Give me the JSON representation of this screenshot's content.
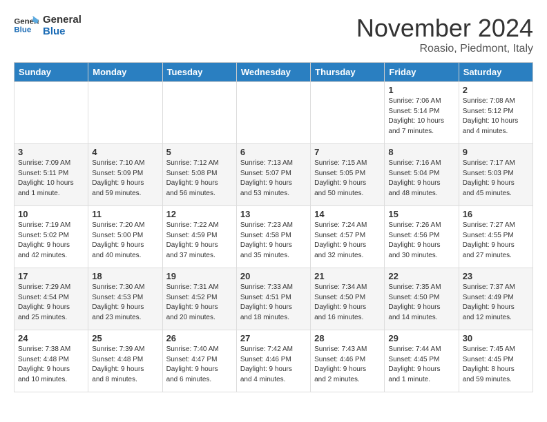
{
  "header": {
    "logo_line1": "General",
    "logo_line2": "Blue",
    "month": "November 2024",
    "location": "Roasio, Piedmont, Italy"
  },
  "weekdays": [
    "Sunday",
    "Monday",
    "Tuesday",
    "Wednesday",
    "Thursday",
    "Friday",
    "Saturday"
  ],
  "weeks": [
    [
      {
        "day": "",
        "info": ""
      },
      {
        "day": "",
        "info": ""
      },
      {
        "day": "",
        "info": ""
      },
      {
        "day": "",
        "info": ""
      },
      {
        "day": "",
        "info": ""
      },
      {
        "day": "1",
        "info": "Sunrise: 7:06 AM\nSunset: 5:14 PM\nDaylight: 10 hours\nand 7 minutes."
      },
      {
        "day": "2",
        "info": "Sunrise: 7:08 AM\nSunset: 5:12 PM\nDaylight: 10 hours\nand 4 minutes."
      }
    ],
    [
      {
        "day": "3",
        "info": "Sunrise: 7:09 AM\nSunset: 5:11 PM\nDaylight: 10 hours\nand 1 minute."
      },
      {
        "day": "4",
        "info": "Sunrise: 7:10 AM\nSunset: 5:09 PM\nDaylight: 9 hours\nand 59 minutes."
      },
      {
        "day": "5",
        "info": "Sunrise: 7:12 AM\nSunset: 5:08 PM\nDaylight: 9 hours\nand 56 minutes."
      },
      {
        "day": "6",
        "info": "Sunrise: 7:13 AM\nSunset: 5:07 PM\nDaylight: 9 hours\nand 53 minutes."
      },
      {
        "day": "7",
        "info": "Sunrise: 7:15 AM\nSunset: 5:05 PM\nDaylight: 9 hours\nand 50 minutes."
      },
      {
        "day": "8",
        "info": "Sunrise: 7:16 AM\nSunset: 5:04 PM\nDaylight: 9 hours\nand 48 minutes."
      },
      {
        "day": "9",
        "info": "Sunrise: 7:17 AM\nSunset: 5:03 PM\nDaylight: 9 hours\nand 45 minutes."
      }
    ],
    [
      {
        "day": "10",
        "info": "Sunrise: 7:19 AM\nSunset: 5:02 PM\nDaylight: 9 hours\nand 42 minutes."
      },
      {
        "day": "11",
        "info": "Sunrise: 7:20 AM\nSunset: 5:00 PM\nDaylight: 9 hours\nand 40 minutes."
      },
      {
        "day": "12",
        "info": "Sunrise: 7:22 AM\nSunset: 4:59 PM\nDaylight: 9 hours\nand 37 minutes."
      },
      {
        "day": "13",
        "info": "Sunrise: 7:23 AM\nSunset: 4:58 PM\nDaylight: 9 hours\nand 35 minutes."
      },
      {
        "day": "14",
        "info": "Sunrise: 7:24 AM\nSunset: 4:57 PM\nDaylight: 9 hours\nand 32 minutes."
      },
      {
        "day": "15",
        "info": "Sunrise: 7:26 AM\nSunset: 4:56 PM\nDaylight: 9 hours\nand 30 minutes."
      },
      {
        "day": "16",
        "info": "Sunrise: 7:27 AM\nSunset: 4:55 PM\nDaylight: 9 hours\nand 27 minutes."
      }
    ],
    [
      {
        "day": "17",
        "info": "Sunrise: 7:29 AM\nSunset: 4:54 PM\nDaylight: 9 hours\nand 25 minutes."
      },
      {
        "day": "18",
        "info": "Sunrise: 7:30 AM\nSunset: 4:53 PM\nDaylight: 9 hours\nand 23 minutes."
      },
      {
        "day": "19",
        "info": "Sunrise: 7:31 AM\nSunset: 4:52 PM\nDaylight: 9 hours\nand 20 minutes."
      },
      {
        "day": "20",
        "info": "Sunrise: 7:33 AM\nSunset: 4:51 PM\nDaylight: 9 hours\nand 18 minutes."
      },
      {
        "day": "21",
        "info": "Sunrise: 7:34 AM\nSunset: 4:50 PM\nDaylight: 9 hours\nand 16 minutes."
      },
      {
        "day": "22",
        "info": "Sunrise: 7:35 AM\nSunset: 4:50 PM\nDaylight: 9 hours\nand 14 minutes."
      },
      {
        "day": "23",
        "info": "Sunrise: 7:37 AM\nSunset: 4:49 PM\nDaylight: 9 hours\nand 12 minutes."
      }
    ],
    [
      {
        "day": "24",
        "info": "Sunrise: 7:38 AM\nSunset: 4:48 PM\nDaylight: 9 hours\nand 10 minutes."
      },
      {
        "day": "25",
        "info": "Sunrise: 7:39 AM\nSunset: 4:48 PM\nDaylight: 9 hours\nand 8 minutes."
      },
      {
        "day": "26",
        "info": "Sunrise: 7:40 AM\nSunset: 4:47 PM\nDaylight: 9 hours\nand 6 minutes."
      },
      {
        "day": "27",
        "info": "Sunrise: 7:42 AM\nSunset: 4:46 PM\nDaylight: 9 hours\nand 4 minutes."
      },
      {
        "day": "28",
        "info": "Sunrise: 7:43 AM\nSunset: 4:46 PM\nDaylight: 9 hours\nand 2 minutes."
      },
      {
        "day": "29",
        "info": "Sunrise: 7:44 AM\nSunset: 4:45 PM\nDaylight: 9 hours\nand 1 minute."
      },
      {
        "day": "30",
        "info": "Sunrise: 7:45 AM\nSunset: 4:45 PM\nDaylight: 8 hours\nand 59 minutes."
      }
    ]
  ]
}
